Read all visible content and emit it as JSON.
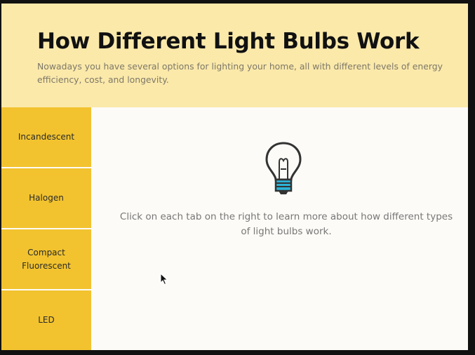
{
  "header": {
    "title": "How Different Light Bulbs Work",
    "subtitle": "Nowadays you have several options for lighting your home, all with different levels of energy efficiency, cost, and longevity."
  },
  "tabs": [
    {
      "label": "Incandescent"
    },
    {
      "label": "Halogen"
    },
    {
      "label": "Compact\nFluorescent"
    },
    {
      "label": "LED"
    }
  ],
  "content": {
    "icon": "light-bulb-icon",
    "instruction": "Click on each tab on the right to learn more about how different types of light bulbs work."
  },
  "colors": {
    "header_bg": "#fbe9aa",
    "tab_bg": "#f2c32f",
    "content_bg": "#fdfbf7",
    "bulb_base_accent": "#2bb3d6"
  }
}
